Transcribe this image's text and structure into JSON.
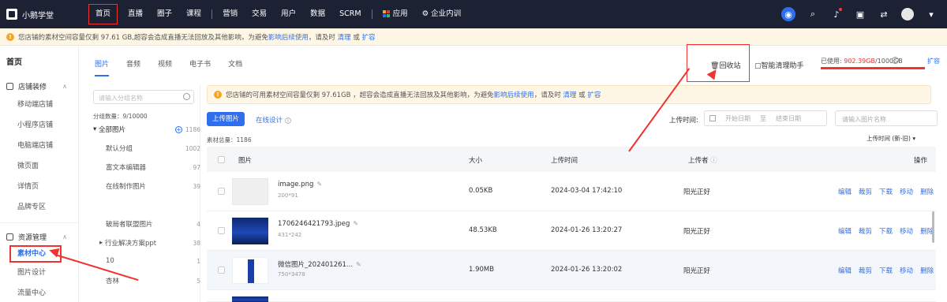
{
  "app": {
    "name": "小鹅学堂"
  },
  "nav": {
    "items": [
      "首页",
      "直播",
      "圈子",
      "课程",
      "营销",
      "交易",
      "用户",
      "数据",
      "SCRM",
      "应用",
      "企业内训"
    ],
    "active": "首页"
  },
  "warn_bar": {
    "text": "您店铺的素材空间容量仅剩 97.61 GB,超容会造成直播无法回放及其他影响，为避免",
    "link1": "影响后续使用",
    "mid": "，请及时",
    "link2": "清理",
    "or": "或",
    "link3": "扩容"
  },
  "sidebar": {
    "title": "首页",
    "groups": [
      {
        "label": "店铺装修",
        "items": [
          "移动端店铺",
          "小程序店铺",
          "电脑端店铺",
          "微页面",
          "详情页",
          "品牌专区"
        ]
      },
      {
        "label": "资源管理",
        "items": [
          "素材中心",
          "图片设计",
          "流量中心"
        ]
      }
    ],
    "active": "素材中心"
  },
  "tabs": [
    "图片",
    "音频",
    "视频",
    "电子书",
    "文档"
  ],
  "active_tab": "图片",
  "toolbar": {
    "recycle": "回收站",
    "clean": "智能清理助手",
    "used_label": "已使用:",
    "used_value": "902.39GB",
    "total_value": "/1000GB",
    "expand": "扩容"
  },
  "tree": {
    "search_placeholder": "请输入分组名称",
    "count": "分组数量：9/10000",
    "all_label": "全部图片",
    "all_count": "1186",
    "groups": [
      {
        "name": "默认分组",
        "count": "1002"
      },
      {
        "name": "富文本编辑器",
        "count": "97"
      },
      {
        "name": "在线制作图片",
        "count": "39"
      },
      {
        "name": "破局者联盟图片",
        "count": "4"
      },
      {
        "name": "行业解决方案ppt",
        "count": "38"
      },
      {
        "name": "10",
        "count": "1"
      },
      {
        "name": "杏林",
        "count": "5"
      }
    ]
  },
  "notice": {
    "text": "您店铺的可用素材空间容量仅剩 97.61GB ，超容会造成直播无法回放及其他影响，为避免",
    "link1": "影响后续使用",
    "mid": "，请及时",
    "link2": "清理",
    "or": "或",
    "link3": "扩容"
  },
  "upload_button": "上传图片",
  "online_design": "在线设计",
  "upload_time_label": "上传时间:",
  "date_start": "开始日期",
  "date_to": "至",
  "date_end": "结束日期",
  "name_search_placeholder": "请输入图片名称",
  "total_label": "素材总量：1186",
  "sort_label": "上传时间 (新-旧)",
  "table": {
    "headers": [
      "图片",
      "大小",
      "上传时间",
      "上传者",
      "操作"
    ],
    "rows": [
      {
        "name": "image.png",
        "dim": "200*91",
        "size": "0.05KB",
        "time": "2024-03-04 17:42:10",
        "uploader": "阳光正好"
      },
      {
        "name": "1706246421793.jpeg",
        "dim": "431*242",
        "size": "48.53KB",
        "time": "2024-01-26 13:20:27",
        "uploader": "阳光正好"
      },
      {
        "name": "微信图片_202401261...",
        "dim": "750*3478",
        "size": "1.90MB",
        "time": "2024-01-26 13:20:02",
        "uploader": "阳光正好"
      }
    ],
    "actions": [
      "编辑",
      "裁剪",
      "下载",
      "移动",
      "删除"
    ]
  },
  "colors": {
    "nav_bg": "#1c2133",
    "accent": "#2f6fed",
    "annotation": "#e33333",
    "warning_bg": "#fff7e6"
  }
}
